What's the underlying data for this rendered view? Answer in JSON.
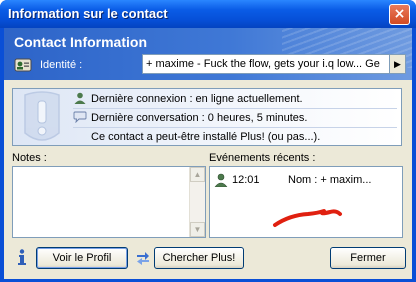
{
  "window": {
    "title": "Information sur le contact",
    "close_label": "×"
  },
  "header": {
    "title": "Contact Information",
    "identity_label": "Identité :",
    "identity_value": "+ maxime - Fuck the flow, gets your i.q low... Ge",
    "arrow_glyph": "▶"
  },
  "info": {
    "last_connection": "Dernière connexion : en ligne actuellement.",
    "last_conversation": "Dernière conversation : 0 heures, 5 minutes.",
    "plus_installed": "Ce contact a peut-être installé Plus! (ou pas...)."
  },
  "notes": {
    "label": "Notes :",
    "value": "",
    "scroll_up": "▲",
    "scroll_down": "▼"
  },
  "events": {
    "label": "Evénements récents :",
    "items": [
      {
        "time": "12:01",
        "text": "Nom : + maxim..."
      }
    ]
  },
  "buttons": {
    "view_profile": "Voir le Profil",
    "search_plus": "Chercher Plus!",
    "close": "Fermer"
  },
  "colors": {
    "titlebar": "#0a5ce6",
    "dialog_bg": "#ece9d8",
    "header_blue": "#3f78d6",
    "annotation_red": "#e02010"
  }
}
